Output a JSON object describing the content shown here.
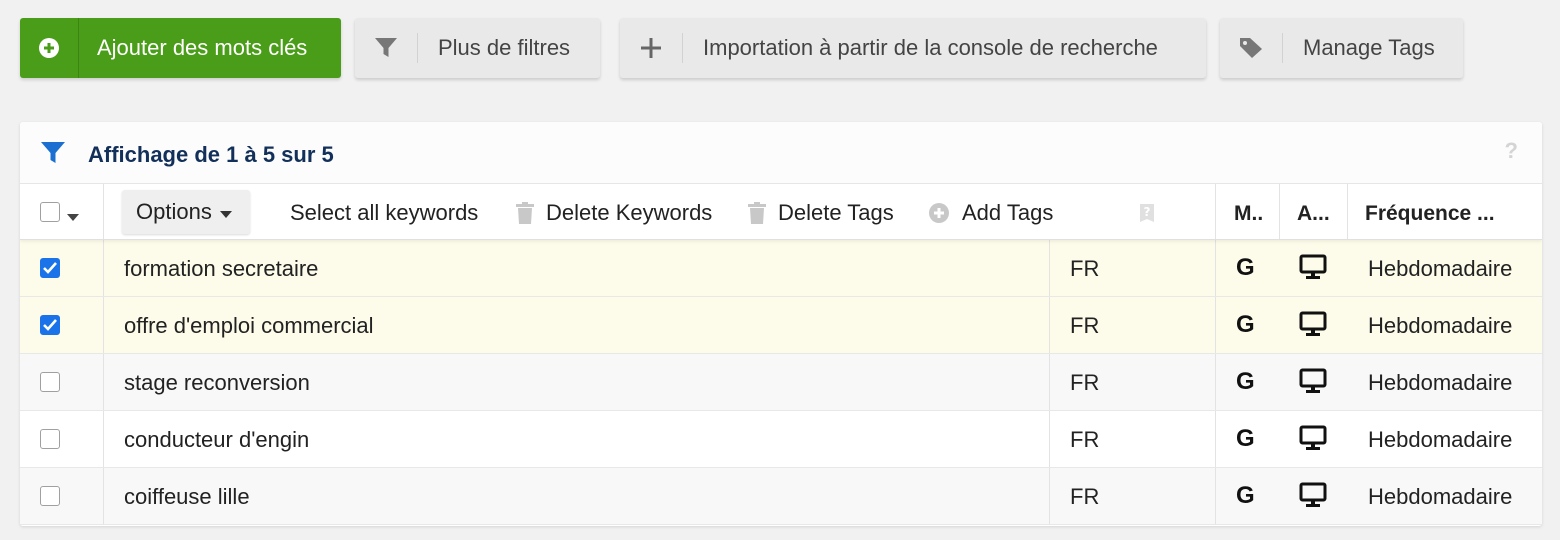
{
  "toolbar": {
    "add_keywords": "Ajouter des mots clés",
    "more_filters": "Plus de filtres",
    "import_console": "Importation à partir de la console de recherche",
    "manage_tags": "Manage Tags"
  },
  "card": {
    "title": "Affichage de 1 à 5 sur 5",
    "help": "?"
  },
  "columns": {
    "options": "Options",
    "select_all": "Select all keywords",
    "delete_keywords": "Delete Keywords",
    "delete_tags": "Delete Tags",
    "add_tags": "Add Tags",
    "engine": "M..",
    "device": "A...",
    "frequency": "Fréquence ..."
  },
  "rows": [
    {
      "keyword": "formation secretaire",
      "lang": "FR",
      "engine": "G",
      "freq": "Hebdomadaire",
      "checked": true
    },
    {
      "keyword": "offre d'emploi commercial",
      "lang": "FR",
      "engine": "G",
      "freq": "Hebdomadaire",
      "checked": true
    },
    {
      "keyword": "stage reconversion",
      "lang": "FR",
      "engine": "G",
      "freq": "Hebdomadaire",
      "checked": false
    },
    {
      "keyword": "conducteur d'engin",
      "lang": "FR",
      "engine": "G",
      "freq": "Hebdomadaire",
      "checked": false
    },
    {
      "keyword": "coiffeuse lille",
      "lang": "FR",
      "engine": "G",
      "freq": "Hebdomadaire",
      "checked": false
    }
  ],
  "colors": {
    "primary_green": "#4a9d18",
    "title_navy": "#12305a",
    "filter_blue": "#1a6fd0",
    "checkbox_blue": "#1a73e8",
    "selected_row": "#fdfbe9"
  },
  "icons": {
    "add": "plus-circle-icon",
    "filter": "funnel-icon",
    "import": "plus-icon",
    "tags": "tag-icon",
    "trash": "trash-icon",
    "add_tag": "plus-circle-icon",
    "help": "question-icon",
    "device": "desktop-icon"
  }
}
